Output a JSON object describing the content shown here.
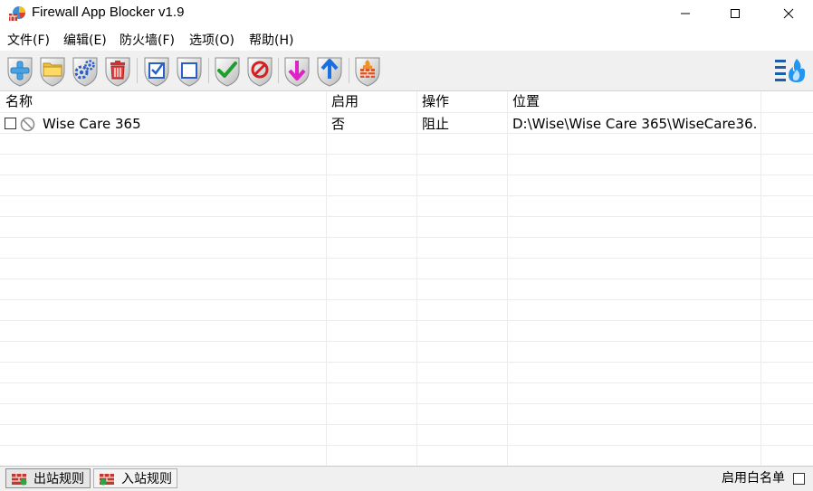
{
  "window": {
    "title": "Firewall App Blocker v1.9"
  },
  "menu": [
    "文件(F)",
    "编辑(E)",
    "防火墙(F)",
    "选项(O)",
    "帮助(H)"
  ],
  "toolbar": {
    "buttons": [
      {
        "name": "add-app-button",
        "icon": "plus-icon"
      },
      {
        "name": "add-folder-button",
        "icon": "folder-icon"
      },
      {
        "name": "add-process-button",
        "icon": "gears-icon"
      },
      {
        "name": "delete-button",
        "icon": "trash-icon"
      },
      {
        "name": "check-all-button",
        "icon": "checkbox-checked-icon"
      },
      {
        "name": "uncheck-all-button",
        "icon": "checkbox-empty-icon"
      },
      {
        "name": "enable-rule-button",
        "icon": "checkmark-icon"
      },
      {
        "name": "disable-rule-button",
        "icon": "block-icon"
      },
      {
        "name": "move-down-button",
        "icon": "arrow-down-icon"
      },
      {
        "name": "move-up-button",
        "icon": "arrow-up-icon"
      },
      {
        "name": "firewall-button",
        "icon": "firewall-icon"
      }
    ],
    "right_icon": "firewall-menu-icon"
  },
  "list": {
    "columns": [
      "名称",
      "启用",
      "操作",
      "位置"
    ],
    "rows": [
      {
        "name": "Wise Care 365",
        "enabled": "否",
        "action": "阻止",
        "path": "D:\\Wise\\Wise Care 365\\WiseCare36...",
        "checked": false,
        "icon": "block-icon"
      }
    ]
  },
  "status": {
    "tabs": [
      {
        "label": "出站规则",
        "active": true
      },
      {
        "label": "入站规则",
        "active": false
      }
    ],
    "whitelist_label": "启用白名单",
    "whitelist_checked": false
  }
}
